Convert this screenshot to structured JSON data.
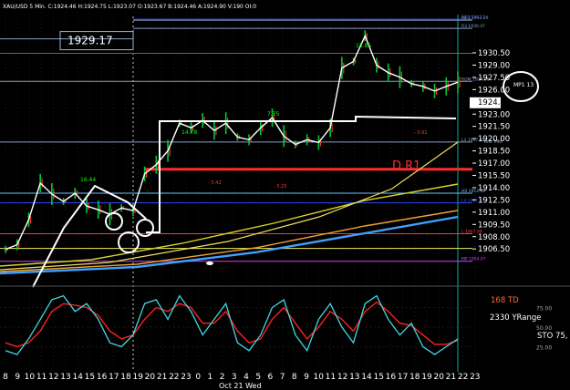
{
  "header": "XAU/USD 5 Min. C:1924.46 H:1924.75 L:1923.07 O:1923.67 B:1924.46 A:1924.90 V:190 OI:0",
  "chart_data": {
    "type": "line",
    "symbol": "XAU/USD",
    "timeframe": "5 Min.",
    "date_label": "Oct 21 Wed",
    "x_tick_labels": [
      "8",
      "9",
      "10",
      "11",
      "12",
      "13",
      "14",
      "15",
      "16",
      "17",
      "18",
      "19",
      "20",
      "21",
      "22",
      "23",
      "0",
      "1",
      "2",
      "3",
      "4",
      "5",
      "6",
      "7",
      "8",
      "9",
      "10",
      "11",
      "12",
      "13",
      "14",
      "15",
      "16",
      "17",
      "18",
      "19",
      "20",
      "21",
      "22",
      "23"
    ],
    "y_tick_labels": [
      "1930.50",
      "1929.00",
      "1927.50",
      "1926.00",
      "1924.46",
      "1923.00",
      "1921.50",
      "1920.00",
      "1918.50",
      "1917.00",
      "1915.50",
      "1914.00",
      "1912.50",
      "1911.00",
      "1909.50",
      "1908.00",
      "1906.50"
    ],
    "ylim": [
      1902.5,
      1932
    ],
    "last_price": 1924.46,
    "price_series": [
      {
        "t": 0,
        "v": 1906.3
      },
      {
        "t": 1,
        "v": 1906.8
      },
      {
        "t": 2,
        "v": 1909.5
      },
      {
        "t": 3,
        "v": 1913.5
      },
      {
        "t": 4,
        "v": 1912.3
      },
      {
        "t": 5,
        "v": 1911.5
      },
      {
        "t": 6,
        "v": 1912.4
      },
      {
        "t": 7,
        "v": 1911.0
      },
      {
        "t": 8,
        "v": 1910.6
      },
      {
        "t": 9,
        "v": 1910.1
      },
      {
        "t": 10,
        "v": 1910.8
      },
      {
        "t": 11,
        "v": 1910.5
      },
      {
        "t": 12,
        "v": 1914.5
      },
      {
        "t": 13,
        "v": 1915.5
      },
      {
        "t": 14,
        "v": 1917.0
      },
      {
        "t": 15,
        "v": 1920.0
      },
      {
        "t": 16,
        "v": 1919.5
      },
      {
        "t": 17,
        "v": 1920.3
      },
      {
        "t": 18,
        "v": 1919.2
      },
      {
        "t": 19,
        "v": 1920.0
      },
      {
        "t": 20,
        "v": 1918.5
      },
      {
        "t": 21,
        "v": 1918.2
      },
      {
        "t": 22,
        "v": 1919.5
      },
      {
        "t": 23,
        "v": 1920.6
      },
      {
        "t": 24,
        "v": 1918.6
      },
      {
        "t": 25,
        "v": 1917.7
      },
      {
        "t": 26,
        "v": 1918.2
      },
      {
        "t": 27,
        "v": 1917.9
      },
      {
        "t": 28,
        "v": 1919.5
      },
      {
        "t": 29,
        "v": 1926.0
      },
      {
        "t": 30,
        "v": 1926.7
      },
      {
        "t": 31,
        "v": 1929.5
      },
      {
        "t": 32,
        "v": 1926.3
      },
      {
        "t": 33,
        "v": 1925.5
      },
      {
        "t": 34,
        "v": 1925.0
      },
      {
        "t": 35,
        "v": 1924.3
      },
      {
        "t": 36,
        "v": 1924.0
      },
      {
        "t": 37,
        "v": 1923.5
      },
      {
        "t": 38,
        "v": 1924.0
      },
      {
        "t": 39,
        "v": 1924.46
      }
    ],
    "horizontal_levels": [
      {
        "label": "R1 1934.23",
        "value": 1931.3,
        "color": "#2a4cff"
      },
      {
        "label": "R3 1930.47",
        "value": 1930.3,
        "color": "#8aa0c8"
      },
      {
        "label": "MP1 1931.29",
        "value": 1931.2,
        "color": "#8aa0c8"
      },
      {
        "label": "",
        "value": 1927.6,
        "color": "#8a5a5a"
      },
      {
        "label": "ROM 1924.06",
        "value": 1924.55,
        "color": "#8aa0c8"
      },
      {
        "label": "L3 1917.85",
        "value": 1917.95,
        "color": "#8aa0c8"
      },
      {
        "label": "",
        "value": 1915.0,
        "color": "#ff2b2b"
      },
      {
        "label": "H0 1912.00",
        "value": 1912.4,
        "color": "#70c0ff"
      },
      {
        "label": "L4 1911.37",
        "value": 1911.35,
        "color": "#2a4cff"
      },
      {
        "label": "L 1907.99",
        "value": 1908.0,
        "color": "#ff3a3a"
      },
      {
        "label": "",
        "value": 1906.4,
        "color": "#f0f060"
      },
      {
        "label": "MP 1904.97",
        "value": 1905.0,
        "color": "#cc44ff"
      }
    ],
    "box_levels": [
      {
        "label": "1929.17",
        "value": 1929.17
      }
    ],
    "annotations": [
      {
        "text": "D R1",
        "color": "#ff2b2b"
      },
      {
        "text": "16.44",
        "color": "#00ff00"
      },
      {
        "text": "14.78",
        "color": "#00ff00"
      },
      {
        "text": "7.75",
        "color": "#00ff00"
      },
      {
        "text": "18.85",
        "color": "#00ff00"
      },
      {
        "text": "- 5.42",
        "color": "#ff3333"
      },
      {
        "text": "- 5.25",
        "color": "#ff3333"
      },
      {
        "text": "- 0.91",
        "color": "#ff3333"
      },
      {
        "text": "Yest Mid",
        "color": "#8aa0c8"
      },
      {
        "text": "MP1 13",
        "color": "#ffffff"
      }
    ],
    "indicator": {
      "labels": [
        "168 TD",
        "2330 YRange",
        "STO 75,"
      ],
      "label_colors": [
        "#ff6a3a",
        "#ffffff",
        "#ffffff"
      ],
      "y_tick_labels": [
        "75.00",
        "50.00",
        "25.00"
      ],
      "ylim": [
        0,
        100
      ],
      "stochastic": [
        20,
        15,
        35,
        60,
        85,
        90,
        70,
        80,
        60,
        30,
        25,
        40,
        80,
        85,
        60,
        90,
        70,
        40,
        60,
        80,
        30,
        20,
        40,
        75,
        85,
        40,
        20,
        60,
        80,
        50,
        30,
        80,
        90,
        60,
        40,
        55,
        25,
        15,
        25,
        35
      ],
      "signal": [
        30,
        25,
        30,
        45,
        70,
        80,
        78,
        75,
        65,
        45,
        35,
        40,
        60,
        75,
        70,
        80,
        75,
        55,
        55,
        70,
        45,
        30,
        35,
        60,
        75,
        55,
        35,
        50,
        70,
        60,
        45,
        70,
        82,
        70,
        55,
        52,
        40,
        28,
        28,
        33
      ]
    }
  }
}
